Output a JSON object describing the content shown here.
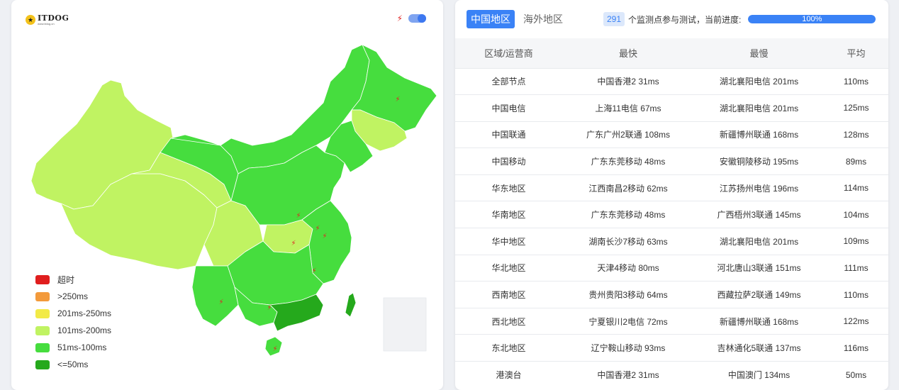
{
  "logo": {
    "main": "ITDOG",
    "sub": "www.itdog.cn"
  },
  "map": {
    "bolt_icon": "⚡",
    "toggle_on": true,
    "legend": [
      {
        "label": "超时",
        "color": "#e01e1e"
      },
      {
        "label": ">250ms",
        "color": "#f39a3b"
      },
      {
        "label": "201ms-250ms",
        "color": "#f2ea47"
      },
      {
        "label": "101ms-200ms",
        "color": "#c0f362"
      },
      {
        "label": "51ms-100ms",
        "color": "#46dd3e"
      },
      {
        "label": "<=50ms",
        "color": "#25a91c"
      }
    ]
  },
  "tabs": [
    {
      "label": "中国地区",
      "active": true
    },
    {
      "label": "海外地区",
      "active": false
    }
  ],
  "probe": {
    "count": "291",
    "text": "个监测点参与测试，当前进度:",
    "progress_label": "100%",
    "progress_value": 1.0
  },
  "table": {
    "headers": [
      "区域/运营商",
      "最快",
      "最慢",
      "平均"
    ],
    "rows": [
      [
        "全部节点",
        "中国香港2 31ms",
        "湖北襄阳电信 201ms",
        "110ms"
      ],
      [
        "中国电信",
        "上海11电信 67ms",
        "湖北襄阳电信 201ms",
        "125ms"
      ],
      [
        "中国联通",
        "广东广州2联通 108ms",
        "新疆博州联通 168ms",
        "128ms"
      ],
      [
        "中国移动",
        "广东东莞移动 48ms",
        "安徽铜陵移动 195ms",
        "89ms"
      ],
      [
        "华东地区",
        "江西南昌2移动 62ms",
        "江苏扬州电信 196ms",
        "114ms"
      ],
      [
        "华南地区",
        "广东东莞移动 48ms",
        "广西梧州3联通 145ms",
        "104ms"
      ],
      [
        "华中地区",
        "湖南长沙7移动 63ms",
        "湖北襄阳电信 201ms",
        "109ms"
      ],
      [
        "华北地区",
        "天津4移动 80ms",
        "河北唐山3联通 151ms",
        "111ms"
      ],
      [
        "西南地区",
        "贵州贵阳3移动 64ms",
        "西藏拉萨2联通 149ms",
        "110ms"
      ],
      [
        "西北地区",
        "宁夏银川2电信 72ms",
        "新疆博州联通 168ms",
        "122ms"
      ],
      [
        "东北地区",
        "辽宁鞍山移动 93ms",
        "吉林通化5联通 137ms",
        "116ms"
      ],
      [
        "港澳台",
        "中国香港2 31ms",
        "中国澳门 134ms",
        "50ms"
      ]
    ]
  }
}
